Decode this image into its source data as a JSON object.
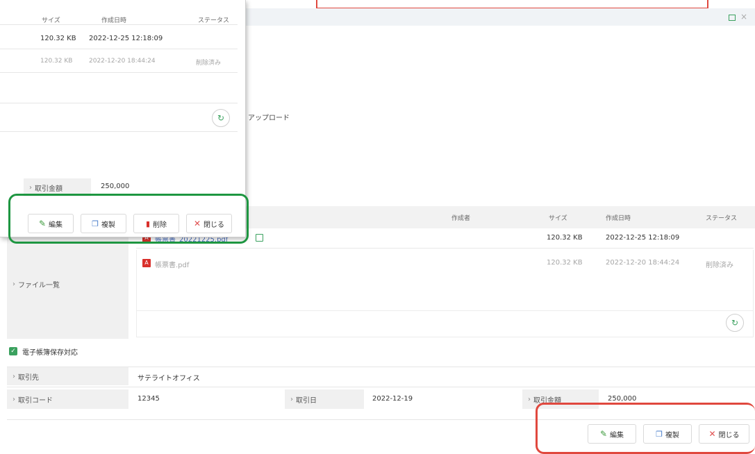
{
  "files": {
    "headers": {
      "author": "作成者",
      "size": "サイズ",
      "created": "作成日時",
      "status": "ステータス"
    },
    "label": "ファイル一覧",
    "rows": [
      {
        "name": "帳票書_20221225.pdf",
        "size": "120.32 KB",
        "created": "2022-12-25 12:18:09",
        "status": ""
      },
      {
        "name": "帳票書.pdf",
        "size": "120.32 KB",
        "created": "2022-12-20 18:44:24",
        "status": "削除済み"
      }
    ]
  },
  "upload_text": "アップロード",
  "checkbox": {
    "label": "電子帳簿保存対応",
    "checked": true
  },
  "fields": {
    "partner_label": "取引先",
    "partner_value": "サテライトオフィス",
    "code_label": "取引コード",
    "code_value": "12345",
    "date_label": "取引日",
    "date_value": "2022-12-19",
    "amount_label": "取引金額",
    "amount_value": "250,000"
  },
  "buttons": {
    "edit": "編集",
    "copy": "複製",
    "delete": "削除",
    "close": "閉じる"
  },
  "popup": {
    "headers": {
      "size": "サイズ",
      "created": "作成日時",
      "status": "ステータス"
    },
    "rows": [
      {
        "size": "120.32 KB",
        "created": "2022-12-25 12:18:09",
        "status": ""
      },
      {
        "size": "120.32 KB",
        "created": "2022-12-20 18:44:24",
        "status": "削除済み"
      }
    ],
    "amount_label": "取引金額",
    "amount_value": "250,000"
  },
  "highlight_colors": {
    "green": "#1e9641",
    "red": "#e0483e"
  }
}
